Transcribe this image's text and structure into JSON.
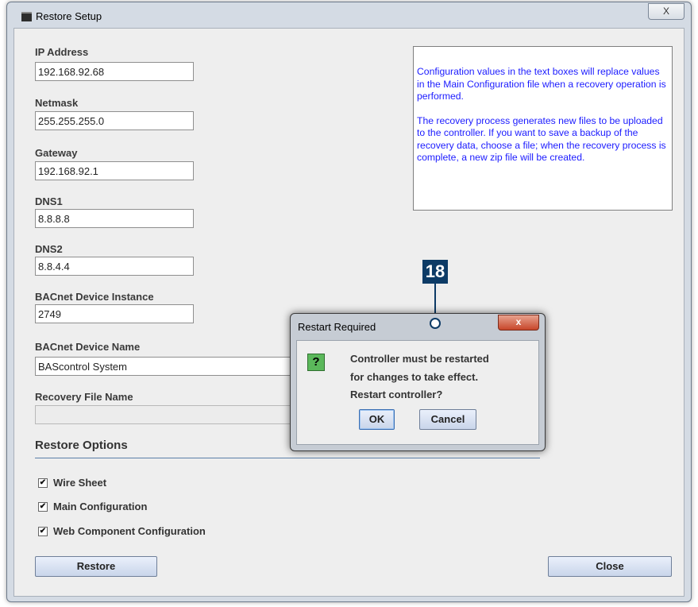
{
  "window": {
    "title": "Restore Setup",
    "close_glyph": "X"
  },
  "fields": {
    "ip": {
      "label": "IP Address",
      "value": "192.168.92.68"
    },
    "netmask": {
      "label": "Netmask",
      "value": "255.255.255.0"
    },
    "gateway": {
      "label": "Gateway",
      "value": "192.168.92.1"
    },
    "dns1": {
      "label": "DNS1",
      "value": "8.8.8.8"
    },
    "dns2": {
      "label": "DNS2",
      "value": "8.8.4.4"
    },
    "bacnet_instance": {
      "label": "BACnet Device Instance",
      "value": "2749"
    },
    "bacnet_name": {
      "label": "BACnet Device Name",
      "value": "BAScontrol System"
    },
    "recovery_file": {
      "label": "Recovery File Name",
      "value": ""
    }
  },
  "info": {
    "p1": "Configuration values in the text boxes will replace values in the Main Configuration file when a recovery operation is performed.",
    "p2": "The recovery process generates new files to be uploaded to the controller. If you want to save a backup of the recovery data, choose a file; when the recovery process is complete, a new zip file will be created."
  },
  "restore_options": {
    "title": "Restore Options",
    "items": [
      {
        "label": "Wire Sheet",
        "checked": true
      },
      {
        "label": "Main Configuration",
        "checked": true
      },
      {
        "label": "Web Component Configuration",
        "checked": true
      }
    ]
  },
  "buttons": {
    "restore": "Restore",
    "close": "Close"
  },
  "callout": {
    "number": "18"
  },
  "dialog": {
    "title": "Restart Required",
    "close_glyph": "x",
    "icon": "question-icon",
    "icon_glyph": "?",
    "lines": [
      "Controller must be restarted",
      "for changes to take effect.",
      "Restart controller?"
    ],
    "ok": "OK",
    "cancel": "Cancel"
  },
  "colors": {
    "info_text": "#1b1bff",
    "callout_bg": "#0d3b66",
    "question_icon": "#5bb85b"
  }
}
